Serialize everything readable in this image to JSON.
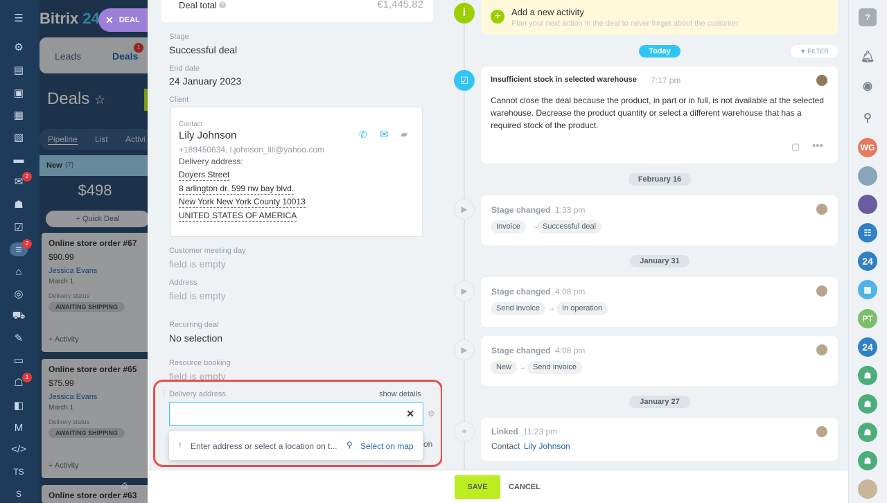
{
  "app": {
    "logo": "Bitrix",
    "logo_num": "24"
  },
  "close_pill": {
    "label": "DEAL"
  },
  "crm": {
    "tabs": [
      {
        "label": "Leads"
      },
      {
        "label": "Deals",
        "badge": "1"
      }
    ],
    "page_title": "Deals",
    "view_tabs": [
      "Pipeline",
      "List",
      "Activi"
    ],
    "column": {
      "name": "New",
      "count": "(7)",
      "sum": "$498",
      "quick_deal": "Quick Deal"
    },
    "cards": [
      {
        "title": "Online store order #67",
        "price": "$90.99",
        "client": "Jessica Evans",
        "date": "March 1",
        "status_label": "Delivery status",
        "status": "AWAITING SHIPPING",
        "activity": "+ Activity"
      },
      {
        "title": "Online store order #65",
        "price": "$75.99",
        "client": "Jessica Evans",
        "date": "March 1",
        "status_label": "Delivery status",
        "status": "AWAITING SHIPPING",
        "activity": "+ Activity"
      },
      {
        "title": "Online store order #63"
      }
    ]
  },
  "nav": {
    "badges": [
      "2",
      "2",
      "1"
    ],
    "bottom": [
      "TS",
      "S"
    ]
  },
  "deal": {
    "deal_total_label": "Deal total",
    "deal_total_value": "€1,445.82",
    "stage_label": "Stage",
    "stage_value": "Successful deal",
    "end_label": "End date",
    "end_value": "24 January 2023",
    "client_label": "Client",
    "contact": {
      "label": "Contact",
      "name": "Lily Johnson",
      "info": "+189450634, l.johnson_lili@yahoo.com",
      "delivery_label": "Delivery address:",
      "address": [
        "Doyers Street",
        "8 arlington dr. 599 nw bay blvd.",
        "New York New York County 10013",
        "UNITED STATES OF AMERICA"
      ]
    },
    "meeting_label": "Customer meeting day",
    "meeting_value": "field is empty",
    "address_label": "Address",
    "address_value": "field is empty",
    "recurring_label": "Recurring deal",
    "recurring_value": "No selection",
    "resource_label": "Resource booking",
    "resource_value": "field is empty",
    "delivery_label": "Delivery address",
    "show_details": "show details",
    "dropdown_text": "Enter address or select a location on t...",
    "select_on_map": "Select on map",
    "behind_text": "on"
  },
  "timeline": {
    "add_activity": {
      "title": "Add a new activity",
      "subtitle": "Plan your next action in the deal to never forget about the customer"
    },
    "today": "Today",
    "filter": "FILTER",
    "alert": {
      "title": "Insufficient stock in selected warehouse",
      "time": "7:17 pm",
      "body": "Cannot close the deal because the product, in part or in full, is not available at the selected warehouse. Decrease the product quantity or select a different warehouse that has a required stock of the product."
    },
    "groups": [
      {
        "date": "February 16"
      },
      {
        "date": "January 31"
      },
      {
        "date": "January 27"
      }
    ],
    "events": [
      {
        "title": "Stage changed",
        "time": "1:33 pm",
        "from": "Invoice",
        "to": "Successful deal"
      },
      {
        "title": "Stage changed",
        "time": "4:08 pm",
        "from": "Send invoice",
        "to": "In operation"
      },
      {
        "title": "Stage changed",
        "time": "4:08 pm",
        "from": "New",
        "to": "Send invoice"
      }
    ],
    "linked": {
      "title": "Linked",
      "time": "11:23 pm",
      "prefix": "Contact",
      "name": "Lily Johnson"
    }
  },
  "footer": {
    "save": "SAVE",
    "cancel": "CANCEL"
  },
  "rightbar": {
    "initials": [
      "WG",
      "PT"
    ],
    "logo": "24"
  },
  "colors": {
    "accent_green": "#bbed21",
    "link": "#2067b0",
    "highlight": "#f14b4b",
    "today": "#2fc6f6"
  }
}
